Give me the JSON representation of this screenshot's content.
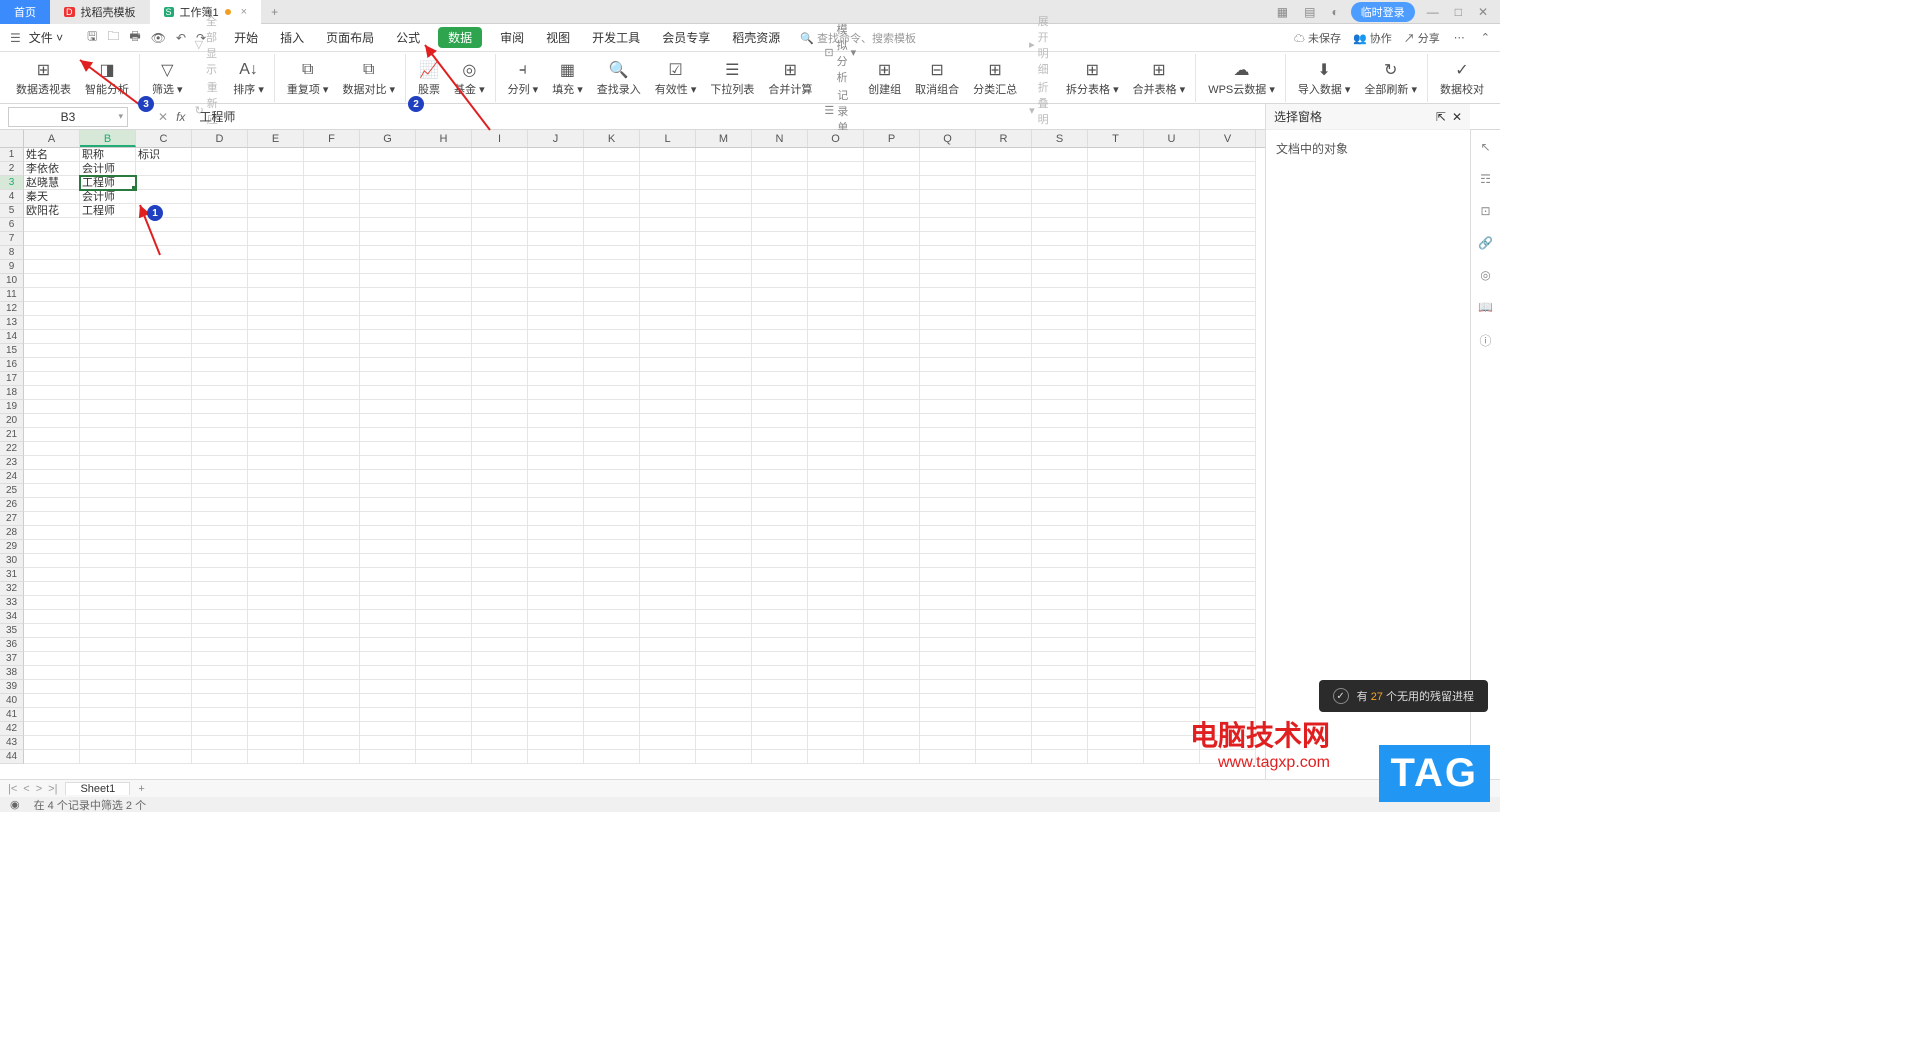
{
  "tabs": {
    "home": "首页",
    "template": "找稻壳模板",
    "workbook": "工作簿1"
  },
  "topRight": {
    "login": "临时登录"
  },
  "fileMenu": "文件",
  "menus": [
    "开始",
    "插入",
    "页面布局",
    "公式",
    "数据",
    "审阅",
    "视图",
    "开发工具",
    "会员专享",
    "稻壳资源"
  ],
  "activeMenuIndex": 4,
  "searchPlaceholder": "查找命令、搜索模板",
  "menuRight": {
    "unsaved": "未保存",
    "coop": "协作",
    "share": "分享"
  },
  "ribbon": {
    "pivot": "数据透视表",
    "smart": "智能分析",
    "filter": "筛选",
    "showAll": "全部显示",
    "reapply": "重新应用",
    "sort": "排序",
    "dup": "重复项",
    "compare": "数据对比",
    "stock": "股票",
    "fund": "基金",
    "split": "分列",
    "fill": "填充",
    "lookup": "查找录入",
    "validity": "有效性",
    "dropdown": "下拉列表",
    "consolidate": "合并计算",
    "record": "记录单",
    "sim": "模拟分析",
    "group": "创建组",
    "ungroup": "取消组合",
    "subtotal": "分类汇总",
    "expand": "展开明细",
    "collapse": "折叠明细",
    "splitTable": "拆分表格",
    "mergeTable": "合并表格",
    "wpsCloud": "WPS云数据",
    "import": "导入数据",
    "refresh": "全部刷新",
    "proof": "数据校对"
  },
  "cellRef": "B3",
  "formula": "工程师",
  "columns": [
    "A",
    "B",
    "C",
    "D",
    "E",
    "F",
    "G",
    "H",
    "I",
    "J",
    "K",
    "L",
    "M",
    "N",
    "O",
    "P",
    "Q",
    "R",
    "S",
    "T",
    "U",
    "V"
  ],
  "gridData": [
    [
      "姓名",
      "职称",
      "标识"
    ],
    [
      "李依依",
      "会计师",
      ""
    ],
    [
      "赵晓慧",
      "工程师",
      ""
    ],
    [
      "秦天",
      "会计师",
      ""
    ],
    [
      "欧阳花",
      "工程师",
      ""
    ]
  ],
  "selectedCell": {
    "row": 3,
    "col": 1
  },
  "rightPanel": {
    "title": "选择窗格",
    "body": "文档中的对象"
  },
  "sheet": {
    "name": "Sheet1"
  },
  "status": "在 4 个记录中筛选 2 个",
  "toast": {
    "prefix": "有 ",
    "count": "27",
    "suffix": " 个无用的残留进程"
  },
  "watermark": {
    "line1": "电脑技术网",
    "line2": "www.tagxp.com"
  },
  "tag": "TAG"
}
